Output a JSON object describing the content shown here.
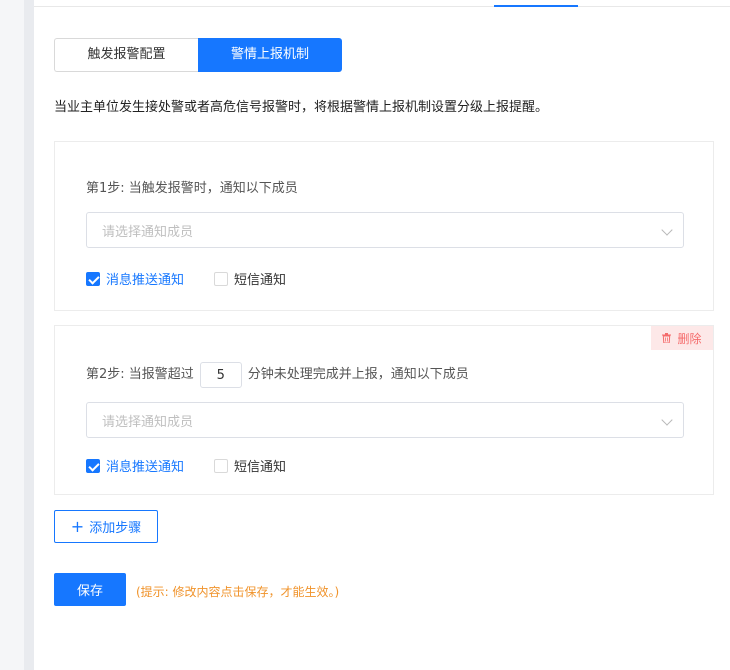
{
  "tabs": {
    "trigger_config": "触发报警配置",
    "escalation": "警情上报机制"
  },
  "description": "当业主单位发生接处警或者高危信号报警时，将根据警情上报机制设置分级上报提醒。",
  "steps": [
    {
      "title": "第1步: 当触发报警时，通知以下成员",
      "select_placeholder": "请选择通知成员",
      "push_label": "消息推送通知",
      "sms_label": "短信通知",
      "push_checked": true,
      "sms_checked": false
    },
    {
      "title_prefix": "第2步: 当报警超过",
      "minutes": "5",
      "title_suffix": "分钟未处理完成并上报，通知以下成员",
      "select_placeholder": "请选择通知成员",
      "push_label": "消息推送通知",
      "sms_label": "短信通知",
      "delete_label": "删除",
      "push_checked": true,
      "sms_checked": false
    }
  ],
  "add_step_label": "添加步骤",
  "save_label": "保存",
  "hint": "(提示: 修改内容点击保存，才能生效。)",
  "colors": {
    "primary": "#1677ff",
    "danger": "#f56c6c",
    "hint": "#f0932b"
  }
}
